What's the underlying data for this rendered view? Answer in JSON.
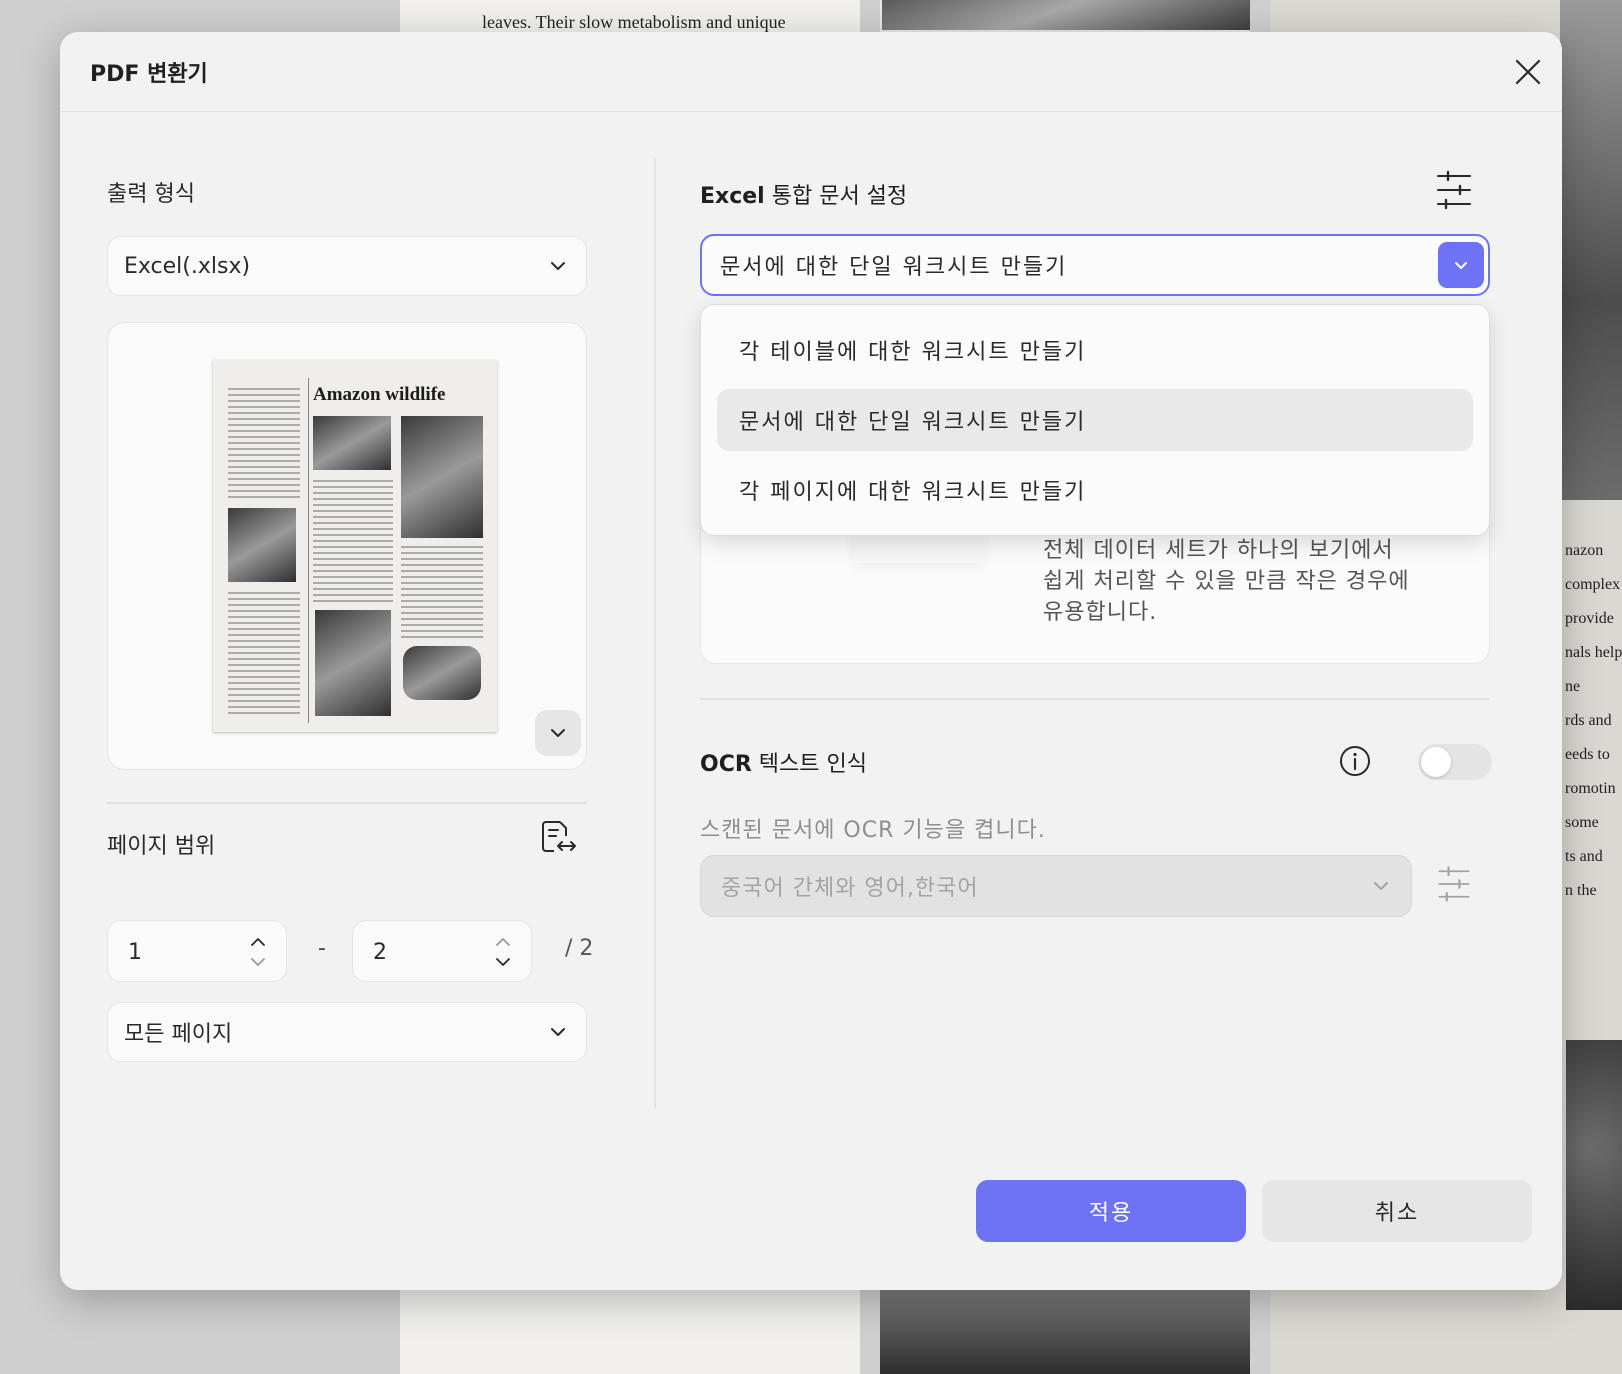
{
  "background": {
    "top_line": "leaves. Their slow metabolism and unique",
    "right_fragments": [
      "nazon",
      "complex",
      "provide",
      "nals help",
      "ne",
      "rds and",
      "eeds to",
      "romotin",
      "some",
      "ts and",
      "n the"
    ]
  },
  "dialog": {
    "title": "PDF 변환기",
    "close_icon": "close-icon"
  },
  "output": {
    "label": "출력 형식",
    "format_value": "Excel(.xlsx)"
  },
  "preview": {
    "thumbnail_title": "Amazon wildlife"
  },
  "page_range": {
    "label": "페이지 범위",
    "from": "1",
    "dash": "-",
    "to": "2",
    "total": "/ 2",
    "mode_value": "모든 페이지"
  },
  "excel_settings": {
    "title_bold": "Excel",
    "title_rest": " 통합 문서 설정",
    "selected_value": "문서에 대한 단일 워크시트 만들기",
    "options": [
      "각 테이블에 대한 워크시트 만들기",
      "문서에 대한 단일 워크시트 만들기",
      "각 페이지에 대한 워크시트 만들기"
    ],
    "selected_index": 1,
    "description_lines": [
      "전체 데이터 세트가 하나의 보기에서",
      "쉽게 처리할 수 있을 만큼 작은 경우에",
      "유용합니다."
    ]
  },
  "ocr": {
    "title_bold": "OCR",
    "title_rest": " 텍스트 인식",
    "enabled": false,
    "description": "스캔된 문서에 OCR 기능을 켭니다.",
    "language_value": "중국어 간체와 영어,한국어"
  },
  "buttons": {
    "apply": "적용",
    "cancel": "취소"
  },
  "colors": {
    "accent": "#6e73f5",
    "dialog_bg": "#f2f2f2"
  }
}
